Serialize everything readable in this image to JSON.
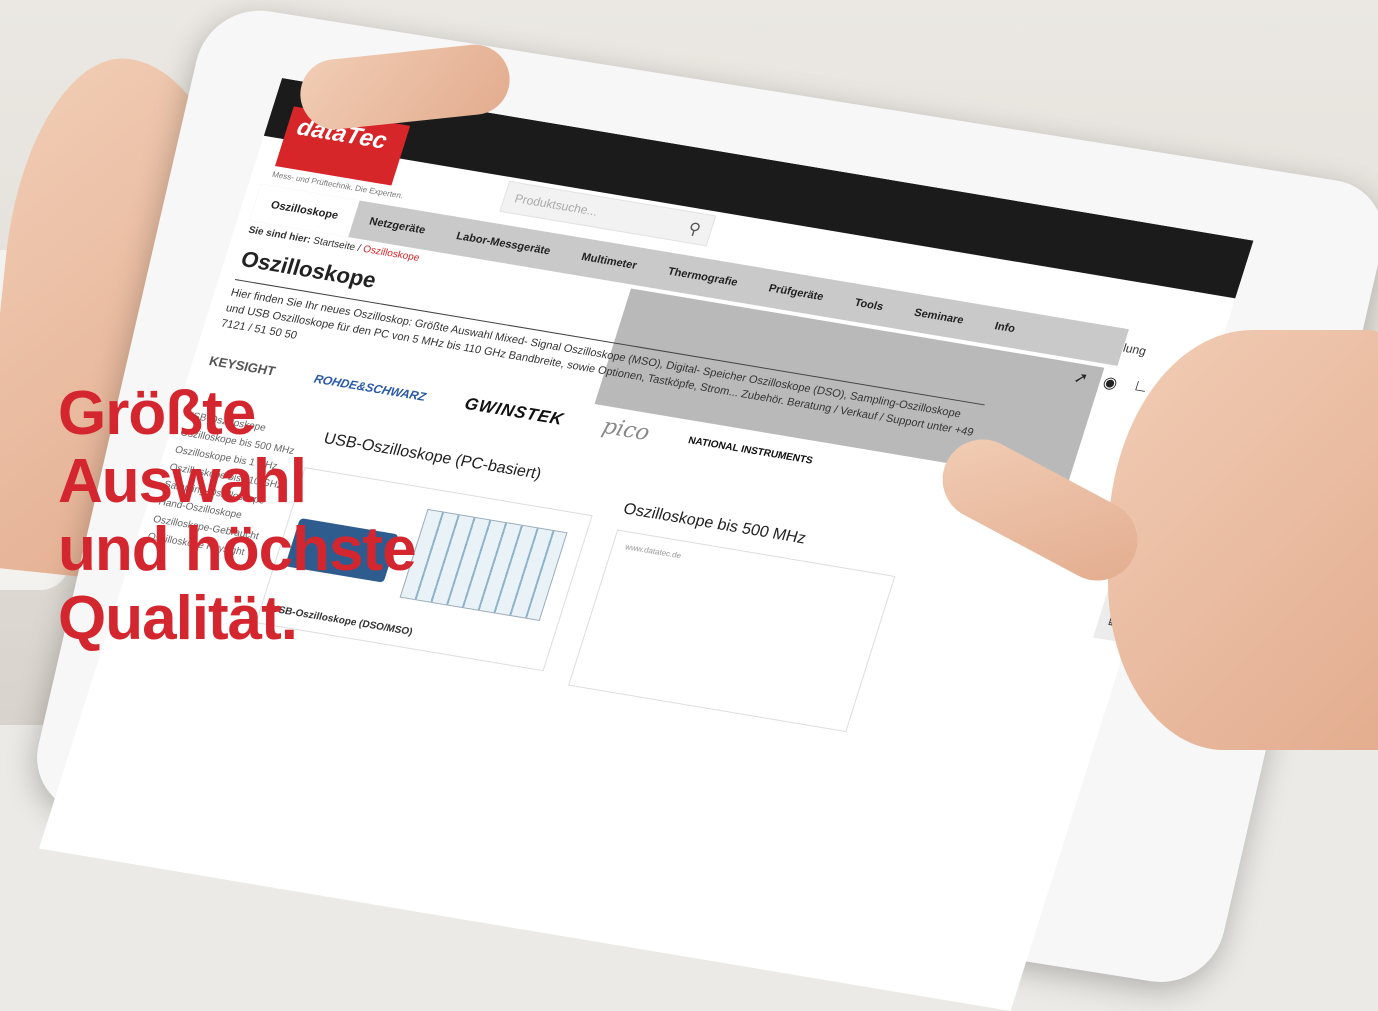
{
  "headline": {
    "lines": [
      "Größte",
      "Auswahl",
      "und höchste",
      "Qualität."
    ]
  },
  "site": {
    "logo": "dataTec",
    "tagline": "Mess- und Prüftechnik. Die Experten.",
    "direktbestellung": "Direktbestellung",
    "search_placeholder": "Produktsuche...",
    "nav": [
      "Oszilloskope",
      "Netzgeräte",
      "Labor-Messgeräte",
      "Multimeter",
      "Thermografie",
      "Prüfgeräte",
      "Tools",
      "Seminare",
      "Info"
    ],
    "breadcrumb": {
      "label": "Sie sind hier:",
      "home": "Startseite",
      "separator": "/",
      "current": "Oszilloskope"
    },
    "page_title": "Oszilloskope",
    "intro": "Hier finden Sie Ihr neues Oszilloskop: Größte Auswahl Mixed- Signal Oszilloskope (MSO), Digital- Speicher Oszilloskope (DSO), Sampling-Oszilloskope und USB Oszilloskope für den PC von 5 MHz bis 110 GHz Bandbreite, sowie Optionen, Tastköpfe, Strom... Zubehör. Beratung / Verkauf / Support unter +49 7121 / 51 50 50",
    "brands": [
      "KEYSIGHT",
      "ROHDE&SCHWARZ",
      "GWINSTEK",
      "pico",
      "NATIONAL INSTRUMENTS"
    ],
    "sidebar": [
      "USB-Oszilloskope",
      "Oszilloskope bis 500 MHz",
      "Oszilloskope bis 1 GHz",
      "Oszilloskope bis 110 GHz",
      "Sampling-Oszilloskope",
      "Hand-Oszilloskope",
      "Oszilloskope-Gebraucht",
      "Oszilloskope Keysight"
    ],
    "sections": {
      "usb_title": "USB-Oszilloskope (PC-basiert)",
      "usb_caption": "USB-Oszilloskope (DSO/MSO)",
      "scope_title": "Oszilloskope bis 500 MHz",
      "scope_url": "www.datatec.de"
    }
  },
  "colors": {
    "brand_red": "#d7262a",
    "headline_red": "#d4262f"
  }
}
